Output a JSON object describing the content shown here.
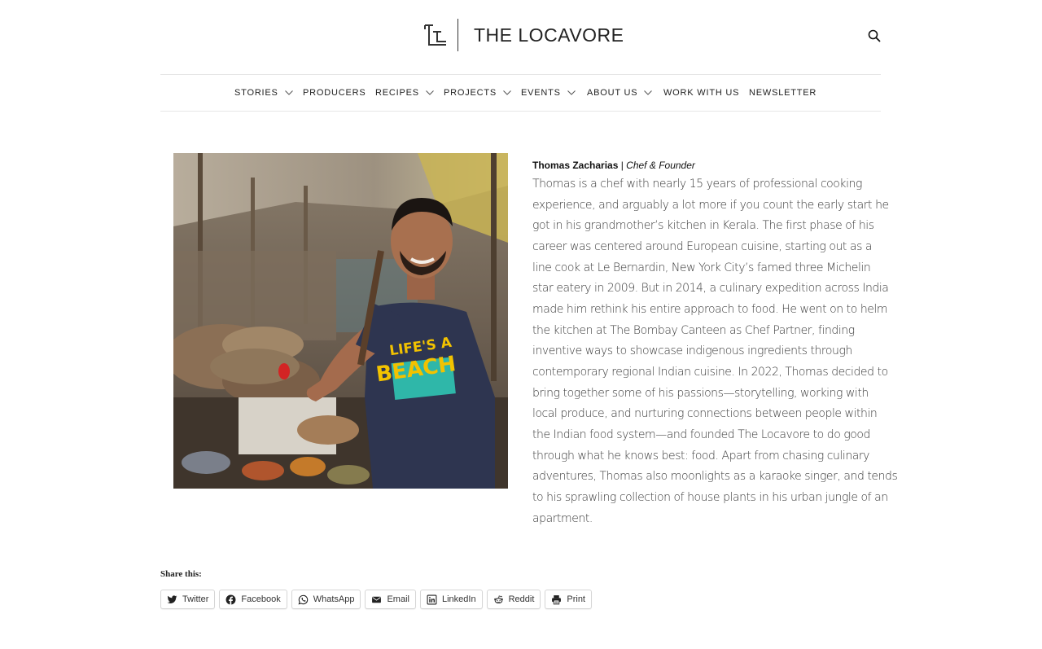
{
  "header": {
    "logo_text": "THE LOCAVORE",
    "logo_icon": "tl-monogram-icon",
    "search_icon": "search-icon"
  },
  "nav": {
    "items": [
      {
        "label": "STORIES",
        "has_dropdown": true
      },
      {
        "label": "PRODUCERS",
        "has_dropdown": false
      },
      {
        "label": "RECIPES",
        "has_dropdown": true
      },
      {
        "label": "PROJECTS",
        "has_dropdown": true
      },
      {
        "label": "EVENTS",
        "has_dropdown": true
      },
      {
        "label": "ABOUT US",
        "has_dropdown": true
      },
      {
        "label": "WORK WITH US",
        "has_dropdown": false
      },
      {
        "label": "NEWSLETTER",
        "has_dropdown": false
      }
    ]
  },
  "profile": {
    "name": "Thomas Zacharias",
    "separator": " | ",
    "role": "Chef & Founder",
    "bio_lines": [
      "Thomas is a chef with nearly 15 years of professional cooking",
      "experience, and arguably a lot more if you count the early start he",
      "got in his grandmother’s kitchen in Kerala. The first phase of his",
      "career was centered around European cuisine, starting out as a",
      "line cook at Le Bernardin, New York City’s famed three Michelin",
      "star eatery in 2009. But in 2014, a culinary expedition across India",
      "made him rethink his entire approach to food. He went on to helm",
      "the kitchen at The Bombay Canteen as Chef Partner, finding",
      "inventive ways to showcase indigenous ingredients through",
      "contemporary regional Indian cuisine. In 2022, Thomas decided to",
      "bring together some of his passions—storytelling, working with",
      "local produce, and nurturing connections between people within",
      "the Indian food system—and founded The Locavore to do good",
      "through what he knows best: food. Apart from chasing culinary",
      "adventures, Thomas also moonlights as a karaoke singer, and tends",
      "to his sprawling collection of house plants in his urban jungle of an",
      "apartment."
    ],
    "tshirt_text_line1": "LIFE'S A",
    "tshirt_text_line2": "BEACH"
  },
  "share": {
    "label": "Share this:",
    "buttons": [
      {
        "label": "Twitter",
        "icon": "twitter-icon"
      },
      {
        "label": "Facebook",
        "icon": "facebook-icon"
      },
      {
        "label": "WhatsApp",
        "icon": "whatsapp-icon"
      },
      {
        "label": "Email",
        "icon": "email-icon"
      },
      {
        "label": "LinkedIn",
        "icon": "linkedin-icon"
      },
      {
        "label": "Reddit",
        "icon": "reddit-icon"
      },
      {
        "label": "Print",
        "icon": "print-icon"
      }
    ]
  }
}
